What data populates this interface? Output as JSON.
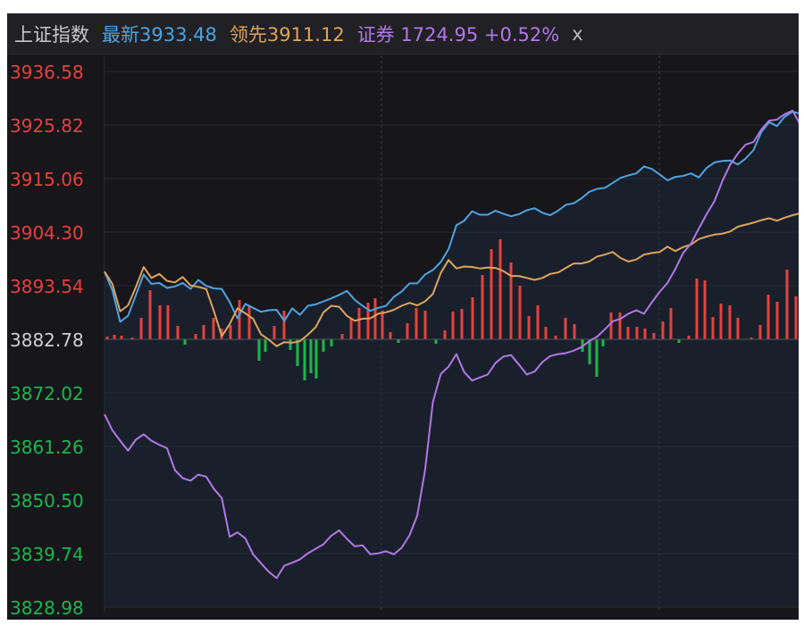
{
  "header": {
    "index_name": "上证指数",
    "latest": "最新3933.48",
    "leading": "领先3911.12",
    "sector": "证券 1724.95 +0.52%",
    "close_label": "x"
  },
  "colors": {
    "background": "#16161b",
    "header_bg": "#202025",
    "up": "#e8413c",
    "down": "#19b84c",
    "latest_line": "#4fa3e0",
    "leading_line": "#e0a35a",
    "sector_line": "#b277e6",
    "index_name": "#c8c8c8",
    "close_label": "#bbbbbb",
    "neutral_tick": "#d0d0d0"
  },
  "chart_data": {
    "type": "line",
    "ylim": [
      3828.98,
      3936.58
    ],
    "baseline": 3882.78,
    "y_ticks": [
      "3936.58",
      "3925.82",
      "3915.06",
      "3904.30",
      "3893.54",
      "3882.78",
      "3872.02",
      "3861.26",
      "3850.50",
      "3839.74",
      "3828.98"
    ],
    "series": [
      {
        "key": "latest",
        "values": [
          3896.4,
          3892.6,
          3886.3,
          3887.5,
          3891.6,
          3895.8,
          3893.9,
          3894.1,
          3893.1,
          3893.4,
          3894.1,
          3892.9,
          3894.7,
          3893.5,
          3893.0,
          3892.9,
          3890.3,
          3887.0,
          3889.9,
          3889.1,
          3888.3,
          3888.6,
          3888.7,
          3886.5,
          3889.0,
          3887.7,
          3889.5,
          3889.8,
          3890.4,
          3891.0,
          3891.7,
          3892.5,
          3890.7,
          3889.5,
          3888.5,
          3889.1,
          3889.5,
          3891.3,
          3892.4,
          3894.0,
          3894.0,
          3895.8,
          3896.7,
          3898.3,
          3900.9,
          3905.7,
          3906.6,
          3908.5,
          3907.8,
          3907.8,
          3908.6,
          3908.0,
          3907.5,
          3907.9,
          3908.7,
          3909.1,
          3908.2,
          3907.7,
          3908.6,
          3909.8,
          3910.1,
          3911.1,
          3912.4,
          3913.0,
          3913.2,
          3914.2,
          3915.2,
          3915.7,
          3916.1,
          3917.5,
          3917.0,
          3915.9,
          3914.7,
          3915.4,
          3915.6,
          3916.1,
          3915.3,
          3917.2,
          3918.3,
          3918.6,
          3918.7,
          3917.9,
          3919.1,
          3920.8,
          3924.4,
          3926.4,
          3925.6,
          3927.5,
          3928.5,
          3928.1
        ],
        "current": 3933.48
      },
      {
        "key": "leading",
        "values": [
          3896.4,
          3893.9,
          3888.4,
          3889.6,
          3893.2,
          3897.3,
          3895.1,
          3895.9,
          3894.5,
          3894.2,
          3895.3,
          3893.6,
          3893.3,
          3892.9,
          3888.4,
          3883.4,
          3885.8,
          3889.0,
          3888.0,
          3886.9,
          3883.8,
          3882.7,
          3881.4,
          3882.2,
          3882.1,
          3882.4,
          3883.7,
          3885.2,
          3888.2,
          3889.5,
          3889.3,
          3887.5,
          3886.5,
          3886.9,
          3887.0,
          3887.9,
          3888.2,
          3888.7,
          3889.5,
          3890.1,
          3889.6,
          3890.4,
          3891.9,
          3896.1,
          3898.7,
          3897.0,
          3897.4,
          3897.3,
          3897.0,
          3897.2,
          3897.1,
          3896.5,
          3895.5,
          3895.5,
          3895.1,
          3894.7,
          3895.1,
          3895.9,
          3896.2,
          3897.1,
          3898.0,
          3898.0,
          3898.4,
          3899.4,
          3899.8,
          3900.3,
          3899.1,
          3898.4,
          3898.8,
          3899.8,
          3900.1,
          3900.3,
          3901.4,
          3900.5,
          3901.3,
          3901.8,
          3902.9,
          3903.4,
          3903.8,
          3904.0,
          3904.4,
          3905.4,
          3905.8,
          3906.2,
          3906.7,
          3907.1,
          3906.6,
          3907.2,
          3907.7,
          3908.1
        ],
        "current": 3911.12
      },
      {
        "key": "sector",
        "values": [
          3867.7,
          3864.5,
          3862.4,
          3860.4,
          3862.6,
          3863.7,
          3862.4,
          3861.6,
          3860.9,
          3856.5,
          3854.9,
          3854.4,
          3855.6,
          3855.2,
          3852.7,
          3850.9,
          3843.1,
          3844.0,
          3842.8,
          3839.6,
          3837.8,
          3836.1,
          3834.8,
          3837.3,
          3837.9,
          3838.6,
          3839.8,
          3840.7,
          3841.6,
          3843.3,
          3844.4,
          3842.7,
          3841.2,
          3841.4,
          3839.6,
          3839.8,
          3840.2,
          3839.6,
          3840.9,
          3843.4,
          3847.4,
          3856.6,
          3870.2,
          3875.8,
          3877.3,
          3879.8,
          3876.2,
          3874.5,
          3875.1,
          3875.7,
          3878.0,
          3879.3,
          3879.6,
          3877.7,
          3875.7,
          3876.3,
          3878.2,
          3879.4,
          3879.8,
          3880.0,
          3880.5,
          3881.2,
          3882.4,
          3883.3,
          3884.8,
          3886.4,
          3886.9,
          3887.9,
          3888.6,
          3887.9,
          3890.2,
          3892.3,
          3894.1,
          3896.9,
          3900.1,
          3902.0,
          3905.0,
          3907.9,
          3910.5,
          3914.5,
          3917.8,
          3920.1,
          3921.9,
          3922.4,
          3924.9,
          3926.7,
          3926.9,
          3928.0,
          3928.7,
          3925.8
        ],
        "current": 1724.95
      }
    ],
    "volume_bars": [
      {
        "x": 120,
        "v": 3
      },
      {
        "x": 128,
        "v": 5
      },
      {
        "x": 136,
        "v": 4
      },
      {
        "x": 148,
        "v": 2
      },
      {
        "x": 158,
        "v": 24
      },
      {
        "x": 168,
        "v": 55
      },
      {
        "x": 179,
        "v": 38
      },
      {
        "x": 188,
        "v": 38
      },
      {
        "x": 199,
        "v": 15
      },
      {
        "x": 207,
        "v": -6
      },
      {
        "x": 219,
        "v": 6
      },
      {
        "x": 228,
        "v": 16
      },
      {
        "x": 239,
        "v": 24
      },
      {
        "x": 248,
        "v": 12
      },
      {
        "x": 258,
        "v": 16
      },
      {
        "x": 268,
        "v": 44
      },
      {
        "x": 279,
        "v": 37
      },
      {
        "x": 290,
        "v": -24
      },
      {
        "x": 297,
        "v": -14
      },
      {
        "x": 307,
        "v": 15
      },
      {
        "x": 318,
        "v": 32
      },
      {
        "x": 325,
        "v": -12
      },
      {
        "x": 333,
        "v": -30
      },
      {
        "x": 341,
        "v": -46
      },
      {
        "x": 348,
        "v": -38
      },
      {
        "x": 354,
        "v": -44
      },
      {
        "x": 362,
        "v": -14
      },
      {
        "x": 371,
        "v": -8
      },
      {
        "x": 383,
        "v": 6
      },
      {
        "x": 393,
        "v": 24
      },
      {
        "x": 402,
        "v": 35
      },
      {
        "x": 412,
        "v": 41
      },
      {
        "x": 420,
        "v": 46
      },
      {
        "x": 428,
        "v": 32
      },
      {
        "x": 437,
        "v": 8
      },
      {
        "x": 446,
        "v": -4
      },
      {
        "x": 456,
        "v": 18
      },
      {
        "x": 466,
        "v": 35
      },
      {
        "x": 476,
        "v": 32
      },
      {
        "x": 488,
        "v": -5
      },
      {
        "x": 498,
        "v": 10
      },
      {
        "x": 507,
        "v": 31
      },
      {
        "x": 517,
        "v": 34
      },
      {
        "x": 529,
        "v": 47
      },
      {
        "x": 540,
        "v": 72
      },
      {
        "x": 550,
        "v": 101
      },
      {
        "x": 560,
        "v": 112
      },
      {
        "x": 572,
        "v": 86
      },
      {
        "x": 582,
        "v": 60
      },
      {
        "x": 592,
        "v": 26
      },
      {
        "x": 602,
        "v": 38
      },
      {
        "x": 611,
        "v": 14
      },
      {
        "x": 622,
        "v": 4
      },
      {
        "x": 633,
        "v": 24
      },
      {
        "x": 643,
        "v": 17
      },
      {
        "x": 652,
        "v": -14
      },
      {
        "x": 660,
        "v": -28
      },
      {
        "x": 668,
        "v": -42
      },
      {
        "x": 675,
        "v": -8
      },
      {
        "x": 684,
        "v": 30
      },
      {
        "x": 694,
        "v": 30
      },
      {
        "x": 703,
        "v": 14
      },
      {
        "x": 713,
        "v": 14
      },
      {
        "x": 722,
        "v": 12
      },
      {
        "x": 732,
        "v": 7
      },
      {
        "x": 742,
        "v": 20
      },
      {
        "x": 751,
        "v": 35
      },
      {
        "x": 760,
        "v": -4
      },
      {
        "x": 771,
        "v": 4
      },
      {
        "x": 780,
        "v": 68
      },
      {
        "x": 789,
        "v": 66
      },
      {
        "x": 798,
        "v": 25
      },
      {
        "x": 807,
        "v": 40
      },
      {
        "x": 817,
        "v": 38
      },
      {
        "x": 826,
        "v": 24
      },
      {
        "x": 841,
        "v": 2
      },
      {
        "x": 851,
        "v": 16
      },
      {
        "x": 860,
        "v": 50
      },
      {
        "x": 870,
        "v": 42
      },
      {
        "x": 881,
        "v": 78
      },
      {
        "x": 891,
        "v": 48
      }
    ]
  }
}
